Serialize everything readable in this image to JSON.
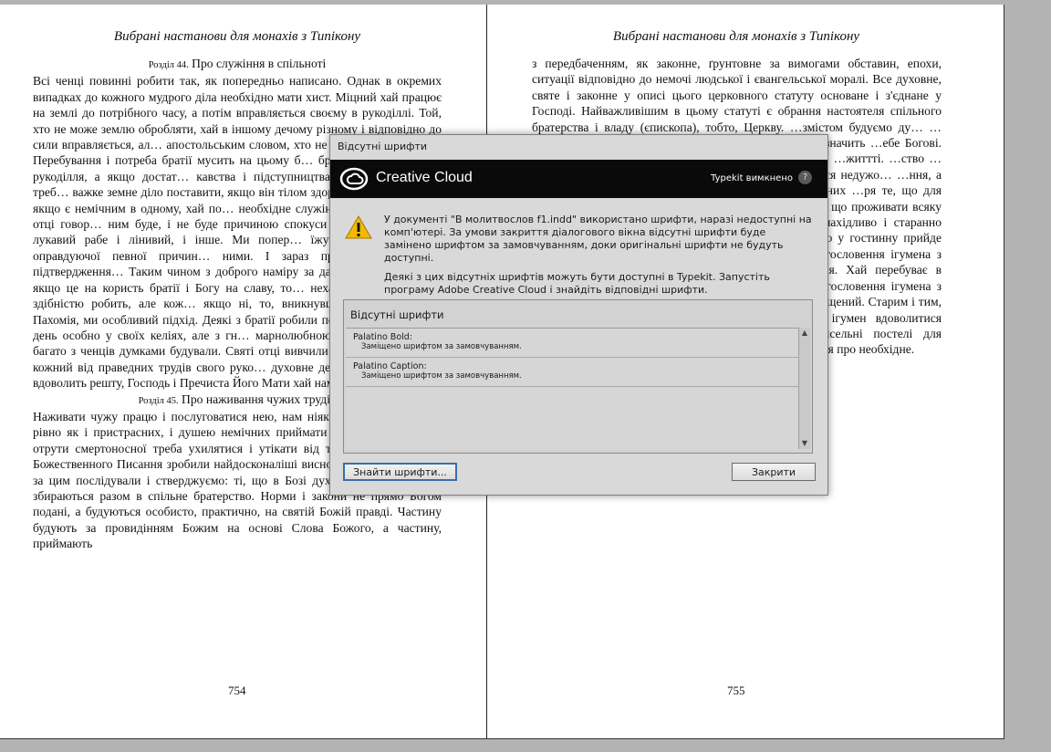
{
  "left_page": {
    "running_head": "Вибрані настанови для монахів з Типікону",
    "section1_num": "Розділ 44.",
    "section1_title": "Про служіння в спільноті",
    "body1": "Всі ченці повинні робити так, як попередньо написано. Однак в окремих випадках до кожного мудрого діла необхідно мати хист. Міцний хай працює на землі до потрібного часу, а потім вправляється своєму в рукоділлі. Той, хто не може землю обробляти, хай в іншому дечому різному і відповідно до сили вправляється, ал… апостольським словом, хто не працює,- каже апо… Перебування і потреба братії мусить на цьому б… братії є малоумним на рукоділля, а якщо достат… кавства і підступництва не вчиться, такого треб… важке земне діло поставити, якщо він тілом здоров… харчуватися. А якщо є немічним в одному, хай по… необхідне служіння, як і божественні отці говор… ним буде, і не буде причиною спокуси для інших Господь: лукавий рабе і лінивий, і інше. Ми попер… їжу і питво, що ради оправдуючої певної причин… ними. І зараз привели благословне підтвердження… Таким чином з доброго наміру за даним законни… бою, якщо це на користь братії і Богу на славу, то… нехай особно, за своєю здібністю робить, але кож… якщо ні, то, вникнувши в життя святого Пахомія, ми особливий підхід. Деякі з братії робили по дві… з очерету) на день особно у своїх келіях, але з гн… марнолюбною щирістю. Так само багато з ченців думками будували. Святі отці вивчили і застерег… ка. Хай кожний від праведних трудів свого руко… духовне денне прохарчування і вдоволить решту, Господь і Пречиста Його Мати хай нами покерую…",
    "section2_num": "Розділ 45.",
    "section2_title": "Про наживання чужих трудів",
    "body2": "Наживати чужу працю і послуговатися нею, нам ніяк не буде на користь, рівно як і пристрасних, і душею немічних приймати в монастир. Тож як отрути смертоносної треба ухилятися і утікати від такого. При це ми з Божественного Писання зробили найдосконаліші висновки. Ми це визнали, за цим послідували і стверджуємо: ті, що в Бозі духовний розум мають, збираються разом в спільне братерство. Норми і закони не прямо Богом подані, а будуються особисто, практично, на святій Божій правді. Частину будують за провидінням Божим на основі Слова Божого, а частину, приймають",
    "folio": "754"
  },
  "right_page": {
    "running_head": "Вибрані настанови для монахів з Типікону",
    "body": "з передбаченням, як законне, ґрунтовне за вимогами обставин, епохи, ситуації відповідно до немочі людської і євангельської моралі. Все духовне, святе і законне у описі цього церковного статуту основане і з'єднане у Господі. Найважливішим в цьому статуті є обрання настоятеля спільного братерства і владу (єпископа), тобто, Церкву. …змістом будуємо ду… …стрій. Прикладемо …ють і розкривають …рське. Це значить …ебе Богові. Чернець …йняти життя розп'я… …нням монаха. І ми …життті. …ство …арство, для тих, що …недугах приходять, …погодиться недужо… …ння, а опісля почне …лікарем в монас… …. Готувати для них …ря те, що для хво… …мед, сушене зілля, Скільки виявиться …ання, що проживати всяку допомогу. …а вказівками лікаря …Лікарі ж хай винахідливо і старанно страждением силу і здоров'я оновлюють. Навіть якщо у гостинну прийде чужинець і бездомок, охоплений недугою, хай з благословення ігумена з недужими від лікаря одержить право на піклування. Хай перебуває в притулку недужих, аж поки вилікується. І тоді з благословення ігумена з молитвою необхідне на дорогу прийме і хай буде відпущений. Старим і тим, що не мають ніякої допомоги, хай благословить ігумен вдоволитися необхідним. Для таких нехай поставить багаточисельні постелі для відпочинку. Доглядач кожного дня від них хай дізнається про необхідне.",
    "folio": "755"
  },
  "dialog": {
    "title": "Відсутні шрифти",
    "brand": "Creative Cloud",
    "typekit_status": "Typekit вимкнено",
    "help": "?",
    "message1": "У документі \"В молитвослов f1.indd\" використано шрифти, наразі недоступні на комп'ютері. За умови закриття діалогового вікна відсутні шрифти буде замінено шрифтом за замовчуванням, доки оригінальні шрифти не будуть доступні.",
    "message2": "Деякі з цих відсутніх шрифтів можуть бути доступні в Typekit. Запустіть програму Adobe Creative Cloud і знайдіть відповідні шрифти.",
    "list_header": "Відсутні шрифти",
    "fonts": [
      {
        "name": "Palatino Bold:",
        "status": "Заміщено шрифтом за замовчуванням."
      },
      {
        "name": "Palatino Caption:",
        "status": "Заміщено шрифтом за замовчуванням."
      }
    ],
    "find_button": "Знайти шрифти...",
    "close_button": "Закрити"
  }
}
